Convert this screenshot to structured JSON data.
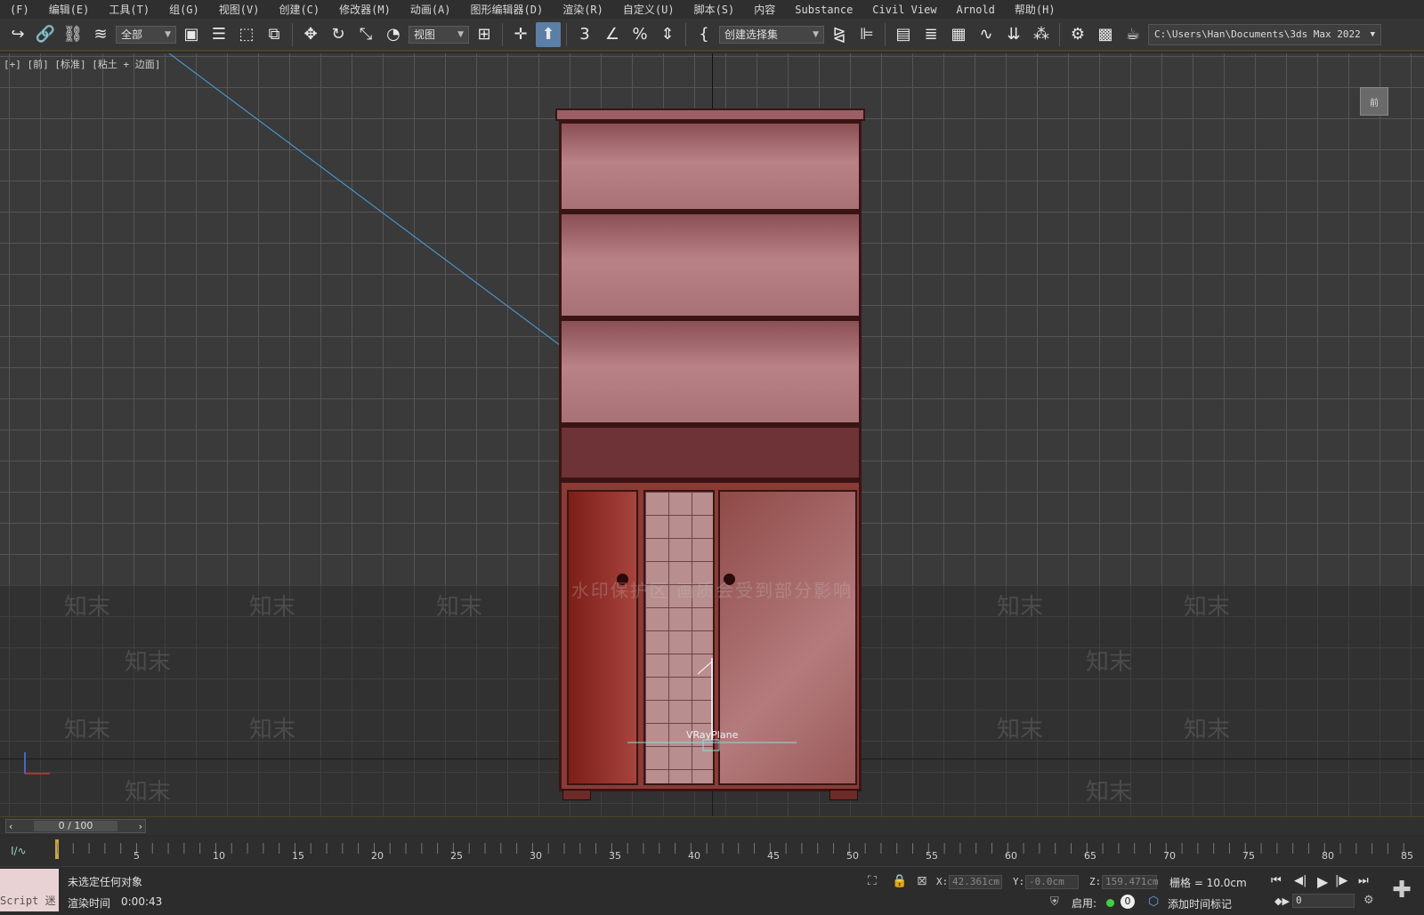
{
  "menu": [
    "(F)",
    "编辑(E)",
    "工具(T)",
    "组(G)",
    "视图(V)",
    "创建(C)",
    "修改器(M)",
    "动画(A)",
    "图形编辑器(D)",
    "渲染(R)",
    "自定义(U)",
    "脚本(S)",
    "内容",
    "Substance",
    "Civil View",
    "Arnold",
    "帮助(H)"
  ],
  "toolbar": {
    "filter_label": "全部",
    "coord_system": "视图",
    "named_selection": "创建选择集",
    "project_path": "C:\\Users\\Han\\Documents\\3ds Max 2022",
    "icons": [
      "redo-icon",
      "link-icon",
      "unlink-icon",
      "bind-spacewarp-icon",
      "select-object-icon",
      "select-by-name-icon",
      "rect-region-icon",
      "window-crossing-icon",
      "move-icon",
      "rotate-icon",
      "scale-icon",
      "placement-icon",
      "pivot-icon",
      "manipulate-icon",
      "snap-3d-icon",
      "angle-snap-icon",
      "percent-snap-icon",
      "spinner-snap-icon",
      "edit-named-sets-icon",
      "mirror-icon",
      "align-icon",
      "scene-explorer-icon",
      "layer-explorer-icon",
      "ribbon-icon",
      "curve-editor-icon",
      "schematic-view-icon",
      "material-editor-icon",
      "render-setup-icon",
      "render-frame-icon",
      "render-production-icon"
    ]
  },
  "viewport": {
    "label": "[+] [前] [标准] [粘土 + 边面]",
    "watermark_notice": "水印保护区  画质会受到部分影响",
    "watermark_text": "知末",
    "object_label": "VRayPlane",
    "viewcube_label": "前"
  },
  "timeline": {
    "frame_display": "0 / 100",
    "ticks": [
      "5",
      "10",
      "15",
      "20",
      "25",
      "30",
      "35",
      "40",
      "45",
      "50",
      "55",
      "60",
      "65",
      "70",
      "75",
      "80",
      "85"
    ]
  },
  "status": {
    "maxscript": "Script 迷",
    "selection": "未选定任何对象",
    "render_time_label": "渲染时间",
    "render_time_value": "0:00:43",
    "x_label": "X:",
    "x_value": "42.361cm",
    "y_label": "Y:",
    "y_value": "-0.0cm",
    "z_label": "Z:",
    "z_value": "159.471cm",
    "grid": "栅格 = 10.0cm",
    "enable_label": "启用:",
    "enable_count": "0",
    "add_time_tag": "添加时间标记",
    "frame_field": "0"
  },
  "colors": {
    "accent_active": "#5b7fa6",
    "cabinet_red": "#8a3b36",
    "timeline_marker": "#c9a83a"
  }
}
